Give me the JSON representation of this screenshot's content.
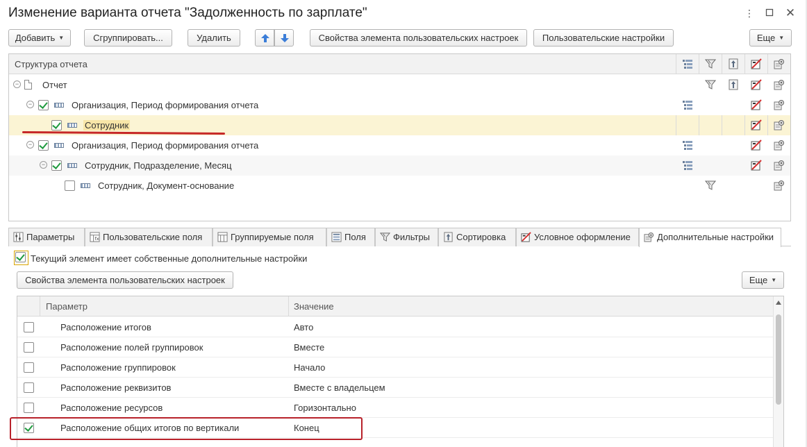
{
  "window": {
    "title": "Изменение варианта отчета \"Задолженность по зарплате\"",
    "more_icon": "more-vertical-icon",
    "maximize_icon": "maximize-icon",
    "close_icon": "close-icon"
  },
  "toolbar": {
    "add_label": "Добавить",
    "group_label": "Сгруппировать...",
    "delete_label": "Удалить",
    "move_up_icon": "arrow-up-icon",
    "move_down_icon": "arrow-down-icon",
    "element_props_label": "Свойства элемента пользовательских настроек",
    "user_settings_label": "Пользовательские настройки",
    "more_label": "Еще"
  },
  "structure": {
    "header": "Структура отчета",
    "columns": [
      "groupings-icon",
      "filter-icon",
      "sort-icon",
      "conditional-format-icon",
      "extra-settings-icon"
    ],
    "rows": [
      {
        "label": "Отчет",
        "level": 0,
        "checkbox": null,
        "expander": true,
        "icon": "document-icon",
        "selected": false,
        "marks": [
          "filter-icon",
          "sort-icon",
          "conditional-format-icon",
          "extra-settings-icon"
        ]
      },
      {
        "label": "Организация, Период формирования отчета",
        "level": 1,
        "checkbox": true,
        "expander": true,
        "icon": "grouping-icon",
        "selected": false,
        "marks": [
          "groupings-icon",
          "conditional-format-icon",
          "extra-settings-icon"
        ]
      },
      {
        "label": "Сотрудник",
        "level": 2,
        "checkbox": true,
        "expander": false,
        "icon": "grouping-icon",
        "selected": true,
        "marks": [
          "conditional-format-icon",
          "extra-settings-icon"
        ]
      },
      {
        "label": "Организация, Период формирования отчета",
        "level": 1,
        "checkbox": true,
        "expander": true,
        "icon": "grouping-icon",
        "selected": false,
        "marks": [
          "groupings-icon",
          "conditional-format-icon",
          "extra-settings-icon"
        ]
      },
      {
        "label": "Сотрудник, Подразделение, Месяц",
        "level": 2,
        "checkbox": true,
        "expander": true,
        "icon": "grouping-icon",
        "selected": false,
        "marks": [
          "groupings-icon",
          "conditional-format-icon",
          "extra-settings-icon"
        ]
      },
      {
        "label": "Сотрудник, Документ-основание",
        "level": 3,
        "checkbox": false,
        "expander": false,
        "icon": "grouping-icon",
        "selected": false,
        "marks": [
          "filter-icon",
          "extra-settings-icon"
        ]
      }
    ]
  },
  "tabs": [
    {
      "label": "Параметры",
      "icon": "parameters-icon",
      "active": false
    },
    {
      "label": "Пользовательские поля",
      "icon": "user-fields-icon",
      "active": false
    },
    {
      "label": "Группируемые поля",
      "icon": "grouped-fields-icon",
      "active": false
    },
    {
      "label": "Поля",
      "icon": "fields-icon",
      "active": false
    },
    {
      "label": "Фильтры",
      "icon": "filter-icon",
      "active": false
    },
    {
      "label": "Сортировка",
      "icon": "sort-icon",
      "active": false
    },
    {
      "label": "Условное оформление",
      "icon": "conditional-format-icon",
      "active": false
    },
    {
      "label": "Дополнительные настройки",
      "icon": "extra-settings-icon",
      "active": true
    }
  ],
  "extra_settings": {
    "own_settings_label": "Текущий элемент имеет собственные дополнительные настройки",
    "own_settings_checked": true,
    "element_props_label": "Свойства элемента пользовательских настроек",
    "more_label": "Еще",
    "columns": {
      "param": "Параметр",
      "value": "Значение"
    },
    "rows": [
      {
        "param": "Расположение итогов",
        "value": "Авто",
        "checked": false
      },
      {
        "param": "Расположение полей группировок",
        "value": "Вместе",
        "checked": false
      },
      {
        "param": "Расположение группировок",
        "value": "Начало",
        "checked": false
      },
      {
        "param": "Расположение реквизитов",
        "value": "Вместе с владельцем",
        "checked": false
      },
      {
        "param": "Расположение ресурсов",
        "value": "Горизонтально",
        "checked": false
      },
      {
        "param": "Расположение общих итогов по вертикали",
        "value": "Конец",
        "checked": true
      }
    ]
  },
  "colors": {
    "accent_blue": "#3b7dd8",
    "check_green": "#1f9a3f",
    "selection": "#fbf4d4",
    "annotation_red": "#b8212a"
  }
}
